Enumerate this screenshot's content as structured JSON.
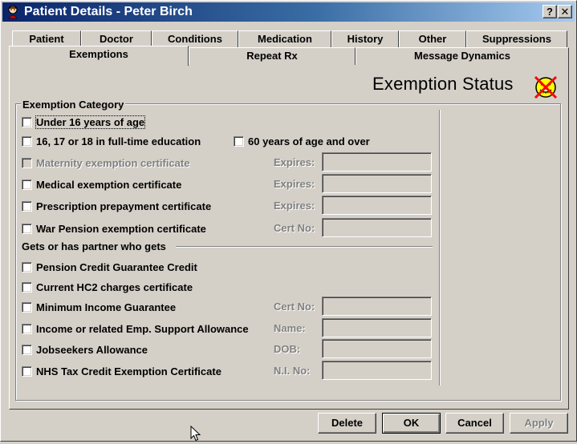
{
  "window": {
    "title": "Patient Details - Peter Birch",
    "help_button": "?",
    "close_button": "✕"
  },
  "tabs_row1": [
    {
      "label": "Patient"
    },
    {
      "label": "Doctor"
    },
    {
      "label": "Conditions"
    },
    {
      "label": "Medication"
    },
    {
      "label": "History"
    },
    {
      "label": "Other"
    },
    {
      "label": "Suppressions"
    }
  ],
  "tabs_row2": [
    {
      "label": "Exemptions",
      "active": true
    },
    {
      "label": "Repeat Rx"
    },
    {
      "label": "Message Dynamics"
    }
  ],
  "status": {
    "title": "Exemption Status",
    "icon": "no-exemption-face-icon"
  },
  "category": {
    "legend": "Exemption Category",
    "under16": "Under 16 years of age",
    "full_time_education": "16, 17 or 18 in full-time education",
    "sixty_and_over": "60 years of age and over",
    "maternity": "Maternity exemption certificate",
    "medical": "Medical exemption certificate",
    "prescription_prepayment": "Prescription prepayment certificate",
    "war_pension": "War Pension exemption certificate",
    "expires_label": "Expires:",
    "cert_no_label": "Cert No:"
  },
  "partner": {
    "legend": "Gets or has partner who gets",
    "pension_credit": "Pension Credit Guarantee Credit",
    "hc2": "Current HC2 charges certificate",
    "min_income": "Minimum Income Guarantee",
    "income_support": "Income or related Emp. Support Allowance",
    "jobseekers": "Jobseekers Allowance",
    "nhs_tax_credit": "NHS Tax Credit Exemption Certificate",
    "cert_no_label": "Cert No:",
    "name_label": "Name:",
    "dob_label": "DOB:",
    "ni_no_label": "N.I. No:"
  },
  "buttons": {
    "delete": "Delete",
    "ok": "OK",
    "cancel": "Cancel",
    "apply": "Apply"
  },
  "colors": {
    "face": "#d4d0c8",
    "title_start": "#0a246a",
    "title_end": "#a6caf0",
    "status_icon_red": "#ff0000",
    "status_icon_yellow": "#ffff00"
  }
}
